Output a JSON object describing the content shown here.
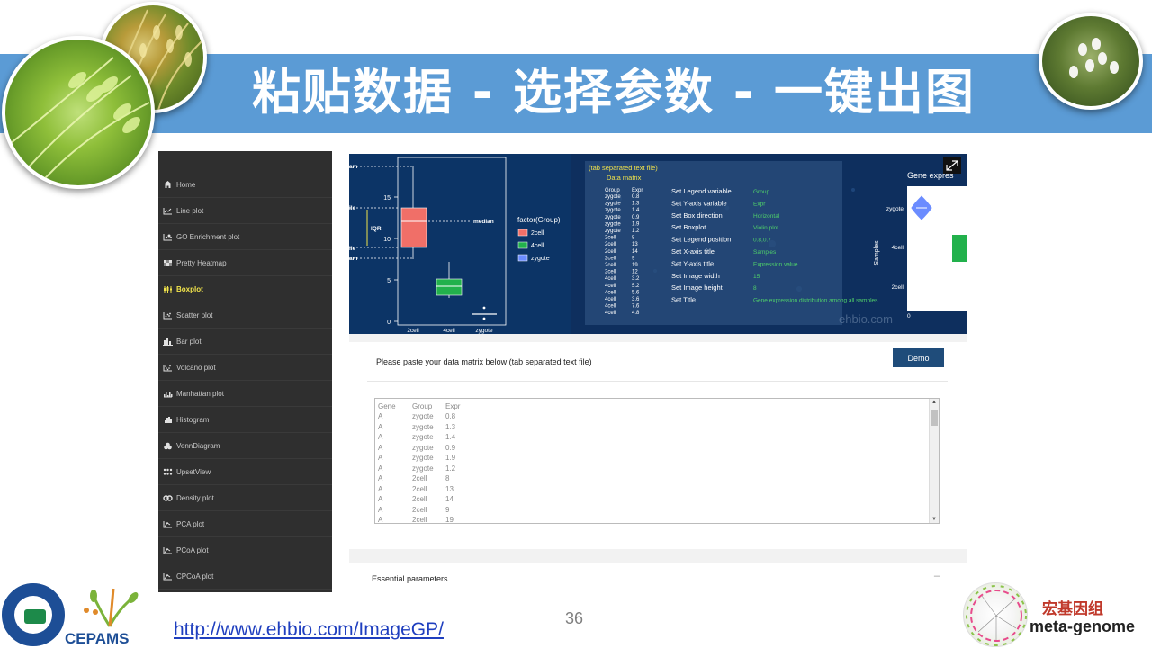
{
  "slide": {
    "title": "粘贴数据 - 选择参数 - 一键出图",
    "url": "http://www.ehbio.com/ImageGP/",
    "page_number": "36",
    "footer_logo_left_text": "CEPAMS",
    "footer_logo_right_cn": "宏基因组",
    "footer_logo_right_en": "meta-genome"
  },
  "sidebar": {
    "items": [
      {
        "label": "Home",
        "icon": "home-icon",
        "active": false
      },
      {
        "label": "Line plot",
        "icon": "line-chart-icon",
        "active": false
      },
      {
        "label": "GO Enrichment plot",
        "icon": "enrichment-icon",
        "active": false
      },
      {
        "label": "Pretty Heatmap",
        "icon": "heatmap-icon",
        "active": false
      },
      {
        "label": "Boxplot",
        "icon": "boxplot-icon",
        "active": true
      },
      {
        "label": "Scatter plot",
        "icon": "scatter-icon",
        "active": false
      },
      {
        "label": "Bar plot",
        "icon": "bar-chart-icon",
        "active": false
      },
      {
        "label": "Volcano plot",
        "icon": "volcano-icon",
        "active": false
      },
      {
        "label": "Manhattan plot",
        "icon": "manhattan-icon",
        "active": false
      },
      {
        "label": "Histogram",
        "icon": "histogram-icon",
        "active": false
      },
      {
        "label": "VennDiagram",
        "icon": "venn-icon",
        "active": false
      },
      {
        "label": "UpsetView",
        "icon": "upset-icon",
        "active": false
      },
      {
        "label": "Density plot",
        "icon": "density-icon",
        "active": false
      },
      {
        "label": "PCA plot",
        "icon": "pca-icon",
        "active": false
      },
      {
        "label": "PCoA plot",
        "icon": "pcoa-icon",
        "active": false
      },
      {
        "label": "CPCoA plot",
        "icon": "cpcoa-icon",
        "active": false
      }
    ],
    "active_color": "#f1e34b"
  },
  "preview": {
    "boxplot": {
      "y_ticks": [
        "15",
        "10",
        "5",
        "0"
      ],
      "x_ticks": [
        "2cell",
        "4cell",
        "zygote"
      ],
      "annotation_labels": [
        "am",
        "ile",
        "ile",
        "am"
      ],
      "iqr_label": "IQR",
      "median_label": "median",
      "legend_title": "factor(Group)",
      "legend_items": [
        {
          "label": "2cell",
          "color": "#f06f68"
        },
        {
          "label": "4cell",
          "color": "#22b14c"
        },
        {
          "label": "zygote",
          "color": "#6b8cff"
        }
      ]
    },
    "data_box": {
      "header": "(tab separated text file)",
      "subheader": "Data matrix",
      "columns": [
        "Group",
        "Expr"
      ],
      "rows": [
        [
          "zygote",
          "0.8"
        ],
        [
          "zygote",
          "1.3"
        ],
        [
          "zygote",
          "1.4"
        ],
        [
          "zygote",
          "0.9"
        ],
        [
          "zygote",
          "1.9"
        ],
        [
          "zygote",
          "1.2"
        ],
        [
          "2cell",
          "8"
        ],
        [
          "2cell",
          "13"
        ],
        [
          "2cell",
          "14"
        ],
        [
          "2cell",
          "9"
        ],
        [
          "2cell",
          "19"
        ],
        [
          "2cell",
          "12"
        ],
        [
          "4cell",
          "3.2"
        ],
        [
          "4cell",
          "5.2"
        ],
        [
          "4cell",
          "5.6"
        ],
        [
          "4cell",
          "3.6"
        ],
        [
          "4cell",
          "7.6"
        ],
        [
          "4cell",
          "4.8"
        ]
      ],
      "settings": [
        {
          "label": "Set Legend variable",
          "value": "Group"
        },
        {
          "label": "Set Y-axis variable",
          "value": "Expr"
        },
        {
          "label": "Set Box direction",
          "value": "Horizontal"
        },
        {
          "label": "Set Boxplot",
          "value": "Violin plot"
        },
        {
          "label": "Set Legend position",
          "value": "0.8,0.7"
        },
        {
          "label": "Set X-axis title",
          "value": "Samples"
        },
        {
          "label": "Set Y-axis title",
          "value": "Expression value"
        },
        {
          "label": "Set Image width",
          "value": "15"
        },
        {
          "label": "Set Image height",
          "value": "8"
        },
        {
          "label": "Set Title",
          "value": "Gene expression distribution among all samples"
        }
      ]
    },
    "violin": {
      "title": "Gene expres",
      "y_label": "Samples",
      "y_ticks": [
        "zygote",
        "4cell",
        "2cell"
      ],
      "x_tick": "0"
    },
    "watermark": "ehbio.com",
    "expand_icon": "expand-icon"
  },
  "panel": {
    "paste_label": "Please paste your data matrix below (tab separated text file)",
    "demo_label": "Demo",
    "columns": [
      "Gene",
      "Group",
      "Expr"
    ],
    "rows": [
      [
        "A",
        "zygote",
        "0.8"
      ],
      [
        "A",
        "zygote",
        "1.3"
      ],
      [
        "A",
        "zygote",
        "1.4"
      ],
      [
        "A",
        "zygote",
        "0.9"
      ],
      [
        "A",
        "zygote",
        "1.9"
      ],
      [
        "A",
        "zygote",
        "1.2"
      ],
      [
        "A",
        "2cell",
        "8"
      ],
      [
        "A",
        "2cell",
        "13"
      ],
      [
        "A",
        "2cell",
        "14"
      ],
      [
        "A",
        "2cell",
        "9"
      ],
      [
        "A",
        "2cell",
        "19"
      ]
    ]
  },
  "essential": {
    "label": "Essential parameters",
    "collapse_symbol": "–"
  },
  "colors": {
    "banner": "#5b9bd5",
    "sidebar": "#2f2f2f",
    "preview_bg": "#0e2f5e",
    "demo_button": "#1f4c7a",
    "url": "#1f3fbf"
  }
}
